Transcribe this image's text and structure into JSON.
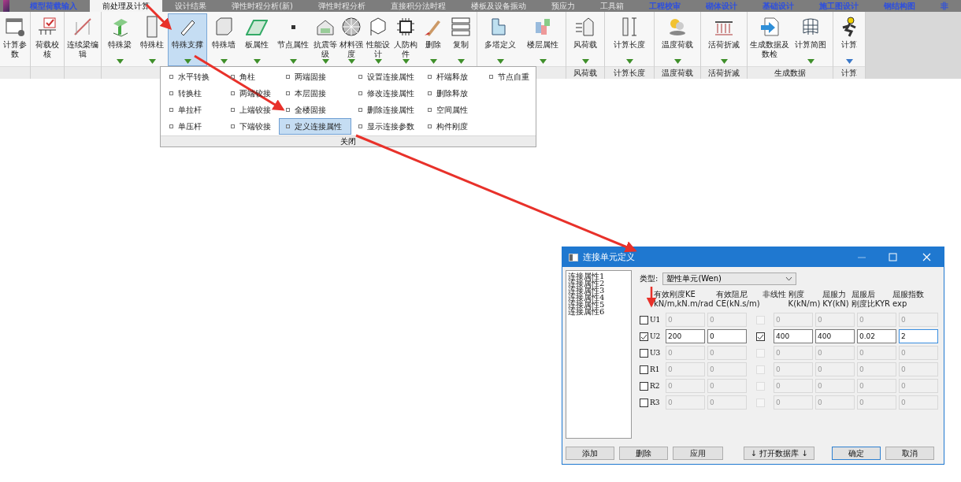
{
  "tabs": [
    {
      "label": "模型荷载输入",
      "kind": "link",
      "selected": false
    },
    {
      "label": "前处理及计算",
      "kind": "plain",
      "selected": true
    },
    {
      "label": "设计结果",
      "kind": "plain",
      "selected": false
    },
    {
      "label": "弹性时程分析(新)",
      "kind": "plain",
      "selected": false
    },
    {
      "label": "弹性时程分析",
      "kind": "plain",
      "selected": false
    },
    {
      "label": "直接积分法时程",
      "kind": "plain",
      "selected": false
    },
    {
      "label": "楼板及设备振动",
      "kind": "plain",
      "selected": false
    },
    {
      "label": "预应力",
      "kind": "plain",
      "selected": false
    },
    {
      "label": "工具箱",
      "kind": "plain",
      "selected": false
    },
    {
      "label": "工程校审",
      "kind": "link",
      "selected": false
    },
    {
      "label": "砌体设计",
      "kind": "link",
      "selected": false
    },
    {
      "label": "基础设计",
      "kind": "link",
      "selected": false
    },
    {
      "label": "施工图设计",
      "kind": "link",
      "selected": false
    },
    {
      "label": "钢结构图",
      "kind": "link",
      "selected": false
    },
    {
      "label": "非",
      "kind": "link",
      "selected": false
    }
  ],
  "ribbon": {
    "groups": [
      {
        "buttons": [
          {
            "label": "计算参数",
            "selected": false
          }
        ]
      },
      {
        "buttons": [
          {
            "label": "荷载校核",
            "selected": false
          }
        ]
      },
      {
        "buttons": [
          {
            "label": "连续梁编辑",
            "selected": false
          }
        ]
      },
      {
        "buttons": [
          {
            "label": "特殊梁",
            "selected": false,
            "color": "#3f8f2a"
          },
          {
            "label": "特殊柱",
            "selected": false,
            "color": "#3f8f2a"
          },
          {
            "label": "特殊支撑",
            "selected": true,
            "color": "#3f8f2a"
          },
          {
            "label": "特殊墙",
            "selected": false,
            "color": "#3f8f2a"
          },
          {
            "label": "板属性",
            "selected": false,
            "color": "#3f8f2a"
          },
          {
            "label": "节点属性",
            "selected": false,
            "color": "#3f8f2a"
          },
          {
            "label": "抗震等级",
            "selected": false,
            "color": "#3f8f2a"
          },
          {
            "label": "材料强度",
            "selected": false,
            "color": "#3f8f2a"
          },
          {
            "label": "性能设计",
            "selected": false,
            "color": "#3f8f2a"
          },
          {
            "label": "人防构件",
            "selected": false,
            "color": "#3f8f2a"
          },
          {
            "label": "删除",
            "selected": false,
            "color": "#3f8f2a"
          },
          {
            "label": "复制",
            "selected": false,
            "color": "#3f8f2a"
          }
        ]
      },
      {
        "buttons": [
          {
            "label": "多塔定义",
            "selected": false,
            "color": "#3f8f2a"
          },
          {
            "label": "楼层属性",
            "selected": false,
            "color": "#3f8f2a"
          }
        ]
      },
      {
        "label": "风荷载",
        "buttons": [
          {
            "label": "风荷载",
            "selected": false,
            "color": "#3f8f2a"
          }
        ]
      },
      {
        "label": "计算长度",
        "buttons": [
          {
            "label": "计算长度",
            "selected": false,
            "color": "#3f8f2a"
          }
        ]
      },
      {
        "label": "温度荷载",
        "buttons": [
          {
            "label": "温度荷载",
            "selected": false,
            "color": "#3f8f2a"
          }
        ]
      },
      {
        "label": "活荷折减",
        "buttons": [
          {
            "label": "活荷折减",
            "selected": false,
            "color": "#3f8f2a"
          }
        ]
      },
      {
        "label": "生成数据",
        "buttons": [
          {
            "label": "生成数据及数检",
            "selected": false
          },
          {
            "label": "计算简图",
            "selected": false,
            "color": "#3f8f2a"
          }
        ]
      },
      {
        "label": "计算",
        "buttons": [
          {
            "label": "计算",
            "selected": false,
            "color": "#3b78c8"
          }
        ]
      }
    ]
  },
  "menu": {
    "columns": [
      [
        {
          "label": "水平转换",
          "selected": false
        },
        {
          "label": "转换柱",
          "selected": false
        },
        {
          "label": "单拉杆",
          "selected": false
        },
        {
          "label": "单压杆",
          "selected": false
        }
      ],
      [
        {
          "label": "角柱",
          "selected": false
        },
        {
          "label": "两端铰接",
          "selected": false
        },
        {
          "label": "上端铰接",
          "selected": false
        },
        {
          "label": "下端铰接",
          "selected": false
        }
      ],
      [
        {
          "label": "两端固接",
          "selected": false
        },
        {
          "label": "本层固接",
          "selected": false
        },
        {
          "label": "全楼固接",
          "selected": false
        },
        {
          "label": "定义连接属性",
          "selected": true
        }
      ],
      [
        {
          "label": "设置连接属性",
          "selected": false
        },
        {
          "label": "修改连接属性",
          "selected": false
        },
        {
          "label": "删除连接属性",
          "selected": false
        },
        {
          "label": "显示连接参数",
          "selected": false
        }
      ],
      [
        {
          "label": "杆端释放",
          "selected": false
        },
        {
          "label": "删除释放",
          "selected": false
        },
        {
          "label": "空间属性",
          "selected": false
        },
        {
          "label": "构件刚度",
          "selected": false
        }
      ],
      [
        {
          "label": "节点自重",
          "selected": false
        }
      ]
    ],
    "footer": "关闭"
  },
  "dialog": {
    "title": "连接单元定义",
    "list": [
      {
        "label": "连接属性1",
        "selected": false
      },
      {
        "label": "连接属性2",
        "selected": false
      },
      {
        "label": "连接属性3",
        "selected": false
      },
      {
        "label": "连接属性4",
        "selected": false
      },
      {
        "label": "连接属性5",
        "selected": false
      },
      {
        "label": "连接属性6",
        "selected": false
      }
    ],
    "type_label": "类型:",
    "type_value": "塑性单元(Wen)",
    "headers": [
      [
        "有效刚度KE",
        "kN/m,kN.m/rad"
      ],
      [
        "有效阻尼",
        "CE(kN.s/m)"
      ],
      [
        "非线性"
      ],
      [
        "刚度",
        "K(kN/m)"
      ],
      [
        "屈服力",
        "KY(kN)"
      ],
      [
        "屈服后",
        "刚度比KYR"
      ],
      [
        "屈服指数",
        "exp"
      ]
    ],
    "rows": [
      {
        "label": "U1",
        "checked": false,
        "nonlinear": false,
        "values": [
          "0",
          "0",
          "0",
          "0",
          "0",
          "0"
        ]
      },
      {
        "label": "U2",
        "checked": true,
        "nonlinear": true,
        "values": [
          "200",
          "0",
          "400",
          "400",
          "0.02",
          "2"
        ]
      },
      {
        "label": "U3",
        "checked": false,
        "nonlinear": false,
        "values": [
          "0",
          "0",
          "0",
          "0",
          "0",
          "0"
        ]
      },
      {
        "label": "R1",
        "checked": false,
        "nonlinear": false,
        "values": [
          "0",
          "0",
          "0",
          "0",
          "0",
          "0"
        ]
      },
      {
        "label": "R2",
        "checked": false,
        "nonlinear": false,
        "values": [
          "0",
          "0",
          "0",
          "0",
          "0",
          "0"
        ]
      },
      {
        "label": "R3",
        "checked": false,
        "nonlinear": false,
        "values": [
          "0",
          "0",
          "0",
          "0",
          "0",
          "0"
        ]
      }
    ],
    "buttons": [
      {
        "label": "添加",
        "kind": "normal"
      },
      {
        "label": "删除",
        "kind": "normal"
      },
      {
        "label": "应用",
        "kind": "normal"
      },
      {
        "label": "↓ 打开数据库 ↓",
        "kind": "normal"
      },
      {
        "label": "确定",
        "kind": "default"
      },
      {
        "label": "取消",
        "kind": "normal"
      }
    ]
  }
}
